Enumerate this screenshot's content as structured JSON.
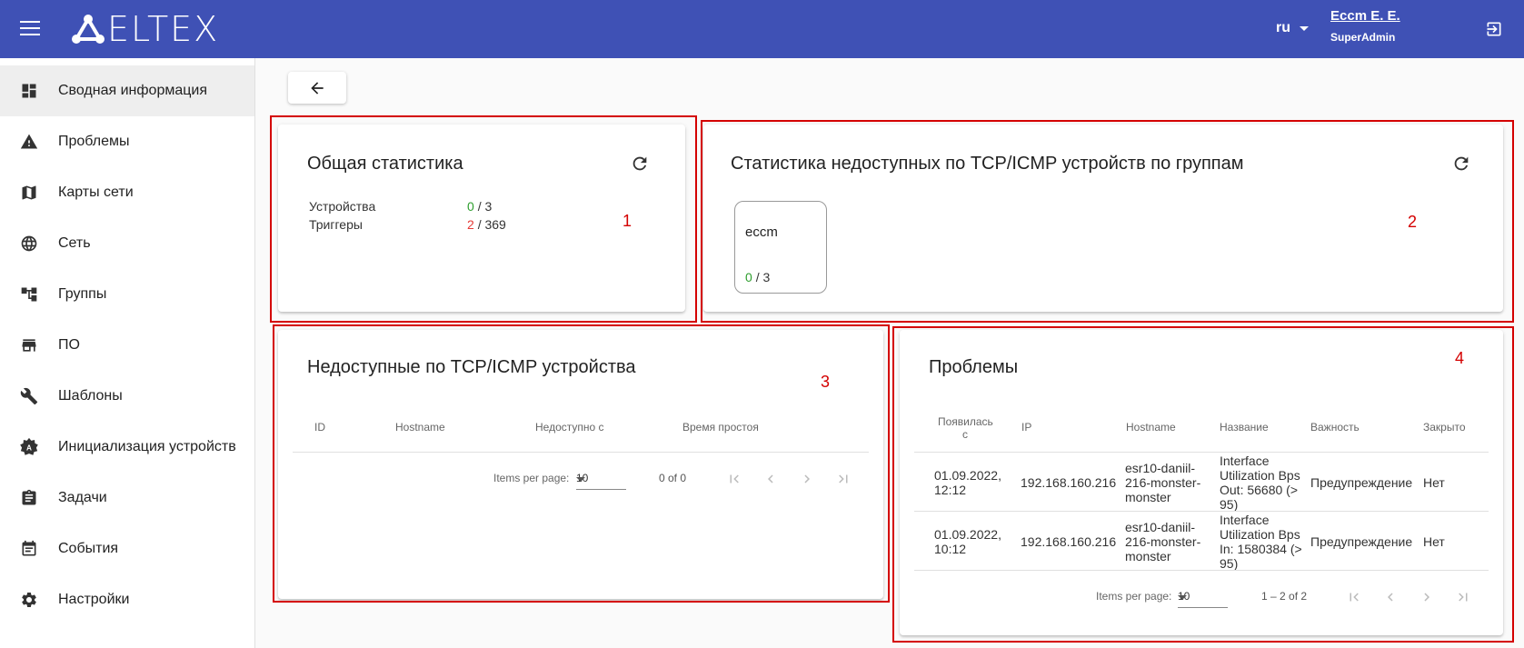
{
  "header": {
    "logo_text": "ELTEX",
    "language": "ru",
    "user_name": "Eccm E. E.",
    "user_role": "SuperAdmin"
  },
  "sidebar": {
    "items": [
      {
        "label": "Сводная информация",
        "icon": "dashboard-icon",
        "active": true
      },
      {
        "label": "Проблемы",
        "icon": "warning-icon"
      },
      {
        "label": "Карты сети",
        "icon": "map-icon"
      },
      {
        "label": "Сеть",
        "icon": "globe-icon"
      },
      {
        "label": "Группы",
        "icon": "hierarchy-icon"
      },
      {
        "label": "ПО",
        "icon": "store-icon"
      },
      {
        "label": "Шаблоны",
        "icon": "wrench-icon"
      },
      {
        "label": "Инициализация устройств",
        "icon": "initialization-icon"
      },
      {
        "label": "Задачи",
        "icon": "clipboard-icon"
      },
      {
        "label": "События",
        "icon": "calendar-icon"
      },
      {
        "label": "Настройки",
        "icon": "gear-icon"
      }
    ]
  },
  "general_stats": {
    "title": "Общая статистика",
    "marker": "1",
    "devices_label": "Устройства",
    "devices_available": "0",
    "devices_total": "/ 3",
    "triggers_label": "Триггеры",
    "triggers_active": "2",
    "triggers_total": "/ 369"
  },
  "group_stats": {
    "title": "Статистика недоступных по TCP/ICMP устройств по группам",
    "marker": "2",
    "groups": [
      {
        "name": "eccm",
        "available": "0",
        "total": "/ 3"
      }
    ]
  },
  "unavailable_devices": {
    "title": "Недоступные по TCP/ICMP устройства",
    "marker": "3",
    "columns": [
      "ID",
      "Hostname",
      "Недоступно с",
      "Время простоя"
    ],
    "items_per_page_label": "Items per page:",
    "items_per_page": "10",
    "range": "0 of 0"
  },
  "problems": {
    "title": "Проблемы",
    "marker": "4",
    "columns": [
      "Появилась с",
      "IP",
      "Hostname",
      "Название",
      "Важность",
      "Закрыто"
    ],
    "rows": [
      {
        "appeared": "01.09.2022, 12:12",
        "ip": "192.168.160.216",
        "hostname": "esr10-daniil-216-monster-monster",
        "name": "Interface Utilization Bps Out: 56680 (> 95)",
        "severity": "Предупреждение",
        "closed": "Нет"
      },
      {
        "appeared": "01.09.2022, 10:12",
        "ip": "192.168.160.216",
        "hostname": "esr10-daniil-216-monster-monster",
        "name": "Interface Utilization Bps In: 1580384 (> 95)",
        "severity": "Предупреждение",
        "closed": "Нет"
      }
    ],
    "items_per_page_label": "Items per page:",
    "items_per_page": "10",
    "range": "1 – 2 of 2"
  },
  "colors": {
    "header": "#3f51b5",
    "accent_green": "#2e9e2e",
    "accent_red": "#e53935",
    "annotation_red": "#d40000"
  }
}
